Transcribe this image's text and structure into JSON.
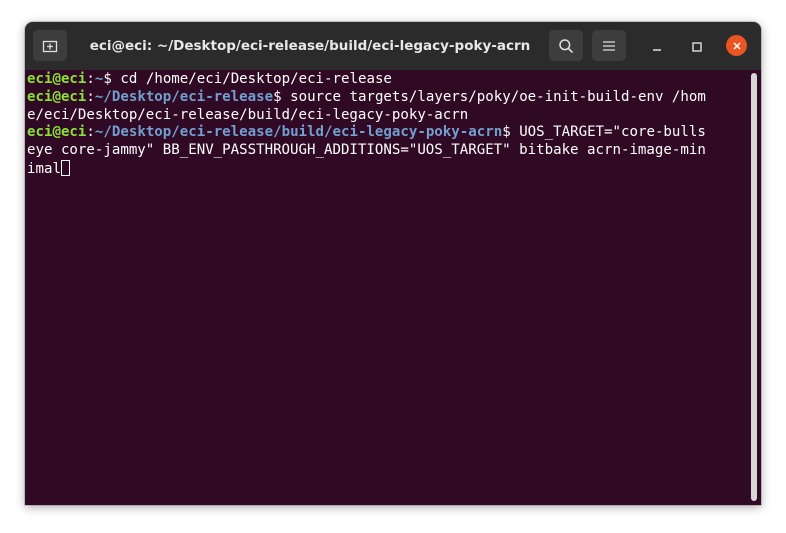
{
  "window": {
    "title": "eci@eci: ~/Desktop/eci-release/build/eci-legacy-poky-acrn"
  },
  "titlebar": {
    "new_tab_icon": "new-tab-icon",
    "search_icon": "search-icon",
    "menu_icon": "hamburger-menu-icon",
    "minimize_icon": "minimize-icon",
    "maximize_icon": "maximize-icon",
    "close_icon": "close-icon"
  },
  "terminal": {
    "line1": {
      "user": "eci@eci",
      "sep": ":",
      "path": "~",
      "prompt": "$ ",
      "command": "cd /home/eci/Desktop/eci-release"
    },
    "line2": {
      "user": "eci@eci",
      "sep": ":",
      "path": "~/Desktop/eci-release",
      "prompt": "$ ",
      "command_part1": "source targets/layers/poky/oe-init-build-env /hom",
      "command_part2": "e/eci/Desktop/eci-release/build/eci-legacy-poky-acrn"
    },
    "line3": {
      "user": "eci@eci",
      "sep": ":",
      "path": "~/Desktop/eci-release/build/eci-legacy-poky-acrn",
      "prompt": "$ ",
      "command_part1": "UOS_TARGET=\"core-bulls",
      "command_part2": "eye core-jammy\" BB_ENV_PASSTHROUGH_ADDITIONS=\"UOS_TARGET\" bitbake acrn-image-min",
      "command_part3": "imal"
    }
  },
  "colors": {
    "background": "#300a24",
    "titlebar": "#2b2b2b",
    "user": "#8ae234",
    "path": "#729fcf",
    "close": "#e95420"
  }
}
